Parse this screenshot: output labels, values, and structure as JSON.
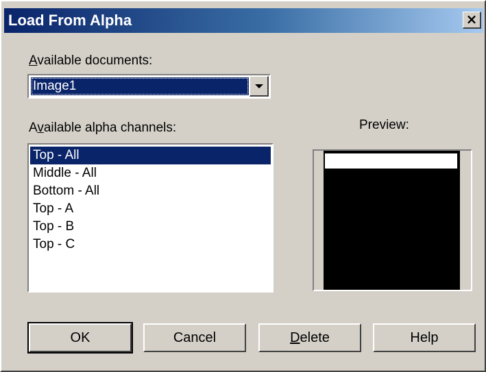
{
  "window": {
    "title": "Load From Alpha",
    "close_glyph": "×",
    "title_gradient": [
      "#0a246a",
      "#a6caf0"
    ]
  },
  "documents": {
    "label_accel": "A",
    "label_rest": "vailable documents:",
    "selected": "Image1"
  },
  "channels": {
    "label_pre": "A",
    "label_accel": "v",
    "label_rest": "ailable alpha channels:",
    "items": [
      {
        "label": "Top - All",
        "selected": true
      },
      {
        "label": "Middle - All",
        "selected": false
      },
      {
        "label": "Bottom - All",
        "selected": false
      },
      {
        "label": "Top - A",
        "selected": false
      },
      {
        "label": "Top - B",
        "selected": false
      },
      {
        "label": "Top - C",
        "selected": false
      }
    ]
  },
  "preview": {
    "label": "Preview:"
  },
  "buttons": {
    "ok": "OK",
    "cancel": "Cancel",
    "delete_accel": "D",
    "delete_rest": "elete",
    "help": "Help"
  },
  "icons": {
    "close": "close-icon",
    "dropdown": "chevron-down-icon"
  },
  "colors": {
    "face": "#d4d0c8",
    "selection": "#0a246a"
  }
}
